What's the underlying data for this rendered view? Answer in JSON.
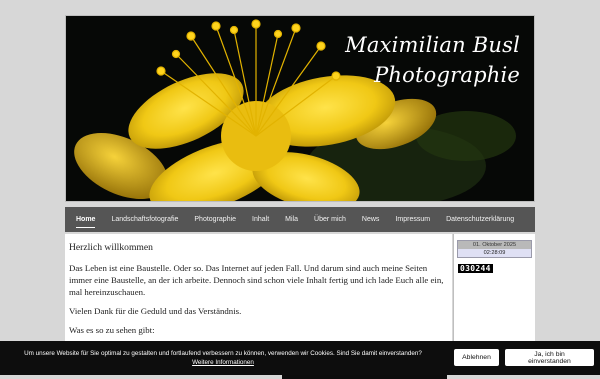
{
  "header": {
    "title_line1": "Maximilian Busl",
    "title_line2": "Photographie"
  },
  "nav": {
    "items": [
      "Home",
      "Landschaftsfotografie",
      "Photographie",
      "Inhalt",
      "Mila",
      "Über mich",
      "News",
      "Impressum",
      "Datenschutzerklärung"
    ],
    "active": "Home"
  },
  "main": {
    "heading": "Herzlich willkommen",
    "paragraph1": "Das Leben ist eine Baustelle. Oder so. Das Internet auf jeden Fall. Und darum sind auch meine Seiten immer eine Baustelle, an der ich arbeite. Dennoch sind schon viele Inhalt fertig und ich lade Euch alle ein, mal hereinzuschauen.",
    "paragraph2": "Vielen Dank für die Geduld und das Verständnis.",
    "paragraph3": "Was es so zu sehen gibt:"
  },
  "sidebar": {
    "date": "01. Oktober 2025",
    "time": "02:28:09",
    "counter": "030244"
  },
  "cookie": {
    "message": "Um unsere Website für Sie optimal zu gestalten und fortlaufend verbessern zu können, verwenden wir Cookies. Sind Sie damit einverstanden?",
    "more_link": "Weitere Informationen",
    "decline_label": "Ablehnen",
    "accept_label": "Ja, ich bin einverstanden"
  }
}
